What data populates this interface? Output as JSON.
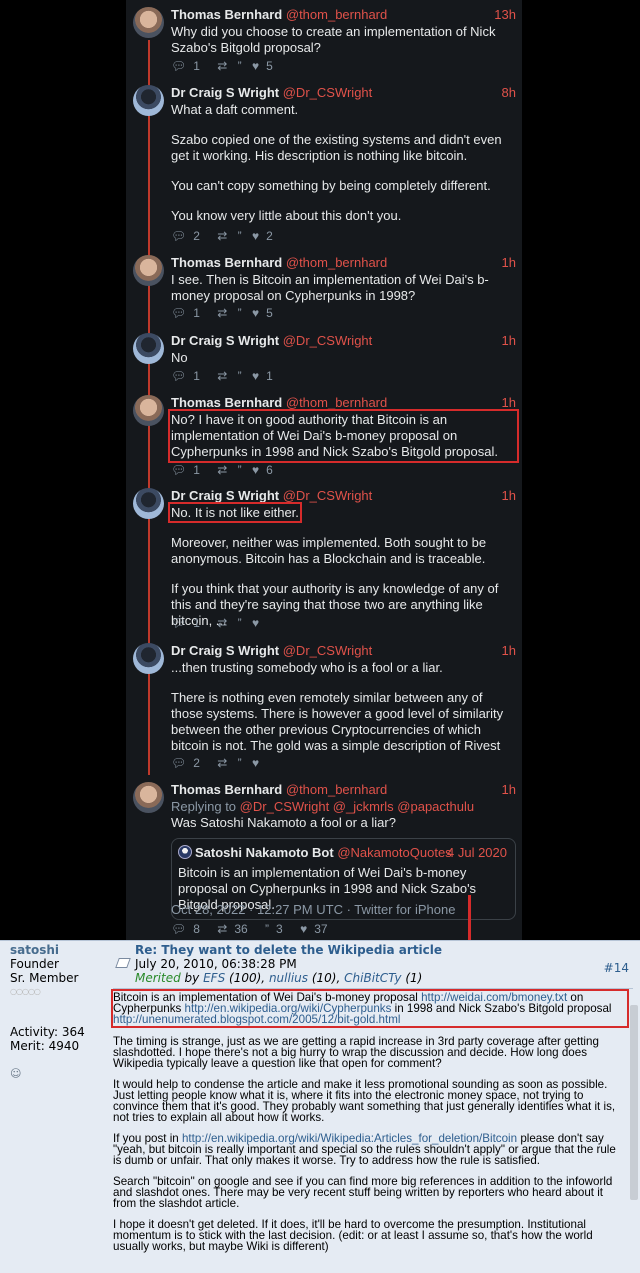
{
  "tweets": [
    {
      "name": "Thomas Bernhard",
      "handle": "@thom_bernhard",
      "time": "13h",
      "paragraphs": [
        "Why did you choose to create an implementation of Nick Szabo's Bitgold proposal?"
      ],
      "replies": "1",
      "likes": "5"
    },
    {
      "name": "Dr Craig S Wright",
      "handle": "@Dr_CSWright",
      "time": "8h",
      "paragraphs": [
        "What a daft comment.",
        "Szabo copied one of the existing systems and didn't even get it working. His description is nothing like bitcoin.",
        "You can't copy something by being completely different.",
        "You know very little about this don't you."
      ],
      "replies": "2",
      "likes": "2"
    },
    {
      "name": "Thomas Bernhard",
      "handle": "@thom_bernhard",
      "time": "1h",
      "paragraphs": [
        "I see. Then is Bitcoin an implementation of Wei Dai's b-money proposal on Cypherpunks in 1998?"
      ],
      "replies": "1",
      "likes": "5"
    },
    {
      "name": "Dr Craig S Wright",
      "handle": "@Dr_CSWright",
      "time": "1h",
      "paragraphs": [
        "No"
      ],
      "replies": "1",
      "likes": "1"
    },
    {
      "name": "Thomas Bernhard",
      "handle": "@thom_bernhard",
      "time": "1h",
      "paragraphs": [
        "No? I have it on good authority that Bitcoin is an implementation of Wei Dai's b-money proposal on Cypherpunks in 1998 and Nick Szabo's Bitgold proposal."
      ],
      "replies": "1",
      "likes": "6"
    },
    {
      "name": "Dr Craig S Wright",
      "handle": "@Dr_CSWright",
      "time": "1h",
      "paragraphs": [
        "No. It is not like either.",
        "Moreover, neither was implemented.  Both sought to be anonymous. Bitcoin has a Blockchain and is traceable.",
        "If you think that your authority is any knowledge of any of this and they're saying that those two are anything like bitcoin, ..."
      ],
      "replies": "1",
      "likes": ""
    },
    {
      "name": "Dr Craig S Wright",
      "handle": "@Dr_CSWright",
      "time": "1h",
      "paragraphs": [
        "...then trusting somebody who is a fool or a liar.",
        "There is nothing even remotely similar between any of those systems. There is however a good level of similarity between the other previous Cryptocurrencies of which bitcoin is not. The gold was a simple description of Rivest"
      ],
      "replies": "2",
      "likes": ""
    },
    {
      "name": "Thomas Bernhard",
      "handle": "@thom_bernhard",
      "time": "1h",
      "replying_label": "Replying to",
      "replying_handles": "@Dr_CSWright @_jckmrls @papacthulu",
      "paragraphs": [
        "Was Satoshi Nakamoto a fool or a liar?"
      ],
      "quote": {
        "name": "Satoshi Nakamoto Bot",
        "handle": "@NakamotoQuotes",
        "date": "4 Jul 2020",
        "text": "Bitcoin is an implementation of Wei Dai's b-money proposal on Cypherpunks in 1998 and Nick Szabo's Bitgold proposal."
      },
      "meta": "Oct 28, 2022 · 12:27 PM UTC · Twitter for iPhone",
      "replies": "8",
      "retweets": "36",
      "quotes": "3",
      "likes": "37"
    }
  ],
  "forum": {
    "poster": {
      "name": "satoshi",
      "rank": "Founder",
      "member": "Sr. Member",
      "stars": "○○○○○",
      "activity": "Activity: 364",
      "merit": "Merit: 4940"
    },
    "post": {
      "title": "Re: They want to delete the Wikipedia article",
      "date": "July 20, 2010, 06:38:28 PM",
      "number": "#14",
      "merited_label": "Merited",
      "merited_by": "by",
      "merit_users": [
        {
          "name": "EFS",
          "count": "(100),"
        },
        {
          "name": "nullius",
          "count": "(10),"
        },
        {
          "name": "ChiBitCTy",
          "count": "(1)"
        }
      ],
      "quote_parts": {
        "a": "Bitcoin is an implementation of Wei Dai's b-money proposal",
        "link1": "http://weidai.com/bmoney.txt",
        "b": "on Cypherpunks",
        "link2": "http://en.wikipedia.org/wiki/Cypherpunks",
        "c": "in 1998 and Nick Szabo's Bitgold proposal",
        "link3": "http://unenumerated.blogspot.com/2005/12/bit-gold.html"
      },
      "p1": "The timing is strange, just as we are getting a rapid increase in 3rd party coverage after getting slashdotted.  I hope there's not a big hurry to wrap the discussion and decide.  How long does Wikipedia typically leave a question like that open for comment?",
      "p2": "It would help to condense the article and make it less promotional sounding as soon as possible.  Just letting people know what it is, where it fits into the electronic money space, not trying to convince them that it's good.  They probably want something that just generally identifies what it is, not tries to explain all about how it works.",
      "p3a": "If you post in",
      "p3link": "http://en.wikipedia.org/wiki/Wikipedia:Articles_for_deletion/Bitcoin",
      "p3b": "please don't say \"yeah, but bitcoin is really important and special so the rules shouldn't apply\" or argue that the rule is dumb or unfair.  That only makes it worse.  Try to address how the rule is satisfied.",
      "p4": "Search \"bitcoin\" on google and see if you can find more big references in addition to the infoworld and slashdot ones.  There may be very recent stuff being written by reporters who heard about it from the slashdot article.",
      "p5": "I hope it doesn't get deleted.  If it does, it'll be hard to overcome the presumption.  Institutional momentum is to stick with the last decision.  (edit: or at least I assume so, that's how the world usually works, but maybe Wiki is different)"
    }
  },
  "colors": {
    "accent": "#e0524a",
    "highlight": "#d62b2b",
    "forum_link": "#2e5e8e",
    "merited": "#2a8a2a"
  }
}
